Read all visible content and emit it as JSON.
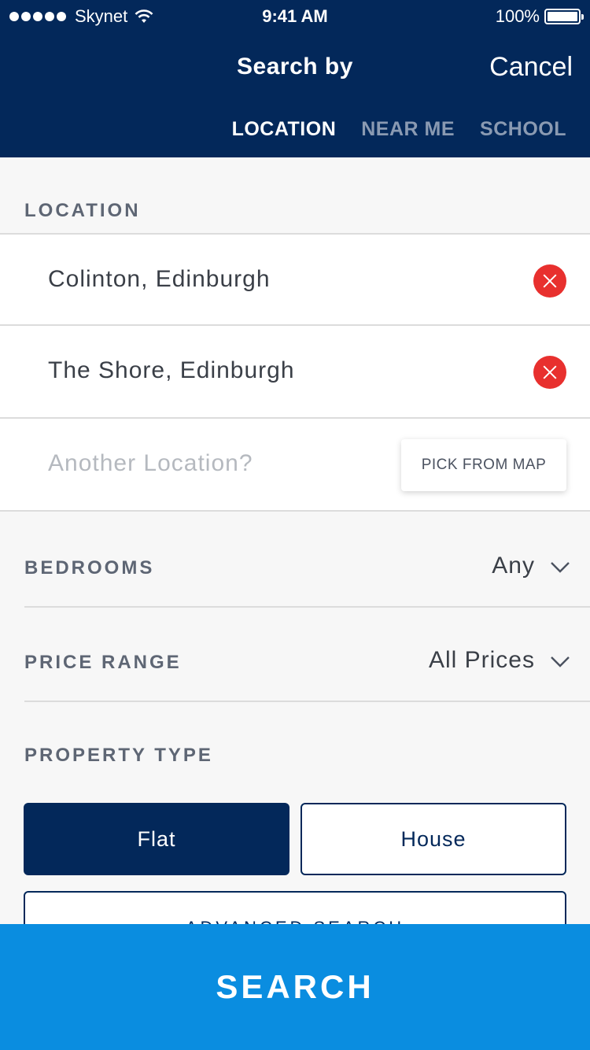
{
  "status_bar": {
    "carrier": "Skynet",
    "time": "9:41 AM",
    "battery": "100%"
  },
  "header": {
    "title": "Search by",
    "cancel_label": "Cancel",
    "tabs": [
      {
        "label": "LOCATION",
        "active": true
      },
      {
        "label": "NEAR ME",
        "active": false
      },
      {
        "label": "SCHOOL",
        "active": false
      }
    ]
  },
  "location": {
    "section_label": "LOCATION",
    "items": [
      {
        "text": "Colinton, Edinburgh"
      },
      {
        "text": "The Shore, Edinburgh"
      }
    ],
    "placeholder": "Another Location?",
    "pick_from_map_label": "PICK FROM MAP"
  },
  "bedrooms": {
    "label": "BEDROOMS",
    "value": "Any"
  },
  "price_range": {
    "label": "PRICE RANGE",
    "value": "All Prices"
  },
  "property_type": {
    "label": "PROPERTY TYPE",
    "options": [
      {
        "label": "Flat",
        "selected": true
      },
      {
        "label": "House",
        "selected": false
      }
    ]
  },
  "advanced_search_label": "ADVANCED SEARCH",
  "search_button_label": "SEARCH",
  "colors": {
    "navy": "#03285a",
    "search_blue": "#0a8de0",
    "remove_red": "#e8302e"
  }
}
